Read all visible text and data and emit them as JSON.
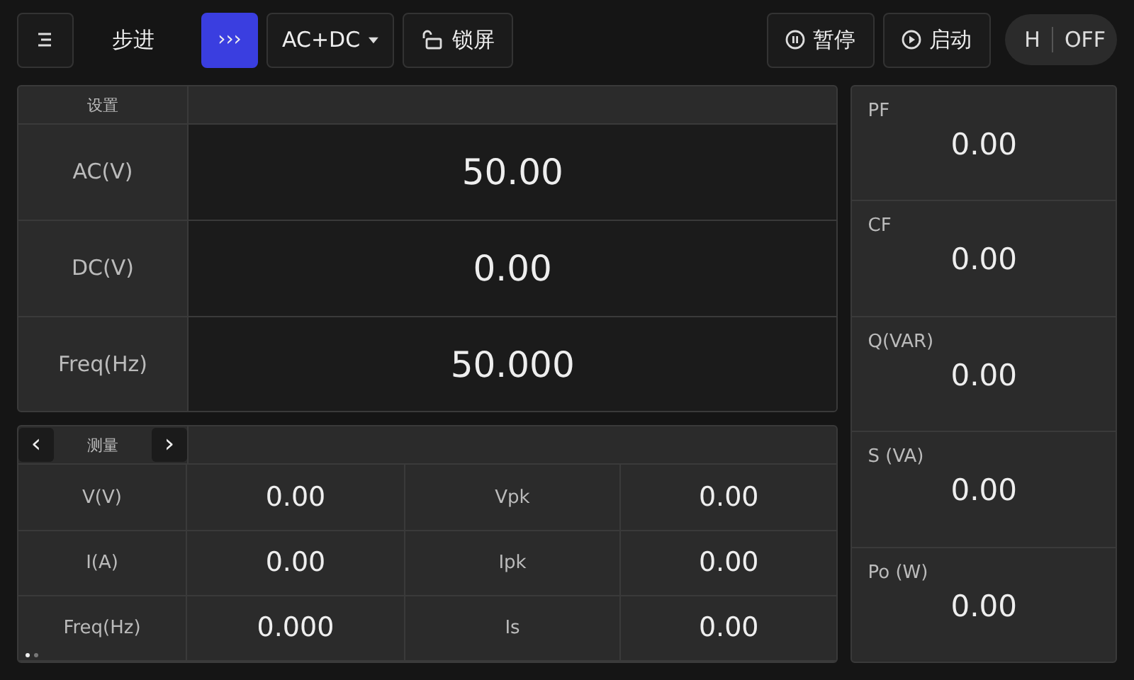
{
  "toolbar": {
    "mode_label": "步进",
    "step_button": {
      "label": "›››",
      "on": true
    },
    "coupling": {
      "value": "AC+DC"
    },
    "lock": {
      "label": "锁屏"
    },
    "pause": {
      "label": "暂停"
    },
    "start": {
      "label": "启动"
    },
    "output_toggle": {
      "label": "H",
      "state": "OFF"
    }
  },
  "settings": {
    "title": "设置",
    "rows": [
      {
        "label": "AC(V)",
        "value": "50.00"
      },
      {
        "label": "DC(V)",
        "value": "0.00"
      },
      {
        "label": "Freq(Hz)",
        "value": "50.000"
      }
    ]
  },
  "measure": {
    "title": "测量",
    "prev": "‹",
    "next": "›",
    "pages": [
      {
        "selected": true
      },
      {
        "selected": false
      }
    ],
    "rows": [
      {
        "label_1": "V(V)",
        "value_1": "0.00",
        "label_2": "Vpk",
        "value_2": "0.00"
      },
      {
        "label_1": "I(A)",
        "value_1": "0.00",
        "label_2": "Ipk",
        "value_2": "0.00"
      },
      {
        "label_1": "Freq(Hz)",
        "value_1": "0.000",
        "label_2": "Is",
        "value_2": "0.00"
      }
    ]
  },
  "readings": [
    {
      "label": "PF",
      "value": "0.00"
    },
    {
      "label": "CF",
      "value": "0.00"
    },
    {
      "label": "Q(VAR)",
      "value": "0.00"
    },
    {
      "label": "S (VA)",
      "value": "0.00"
    },
    {
      "label": "Po (W)",
      "value": "0.00"
    }
  ]
}
